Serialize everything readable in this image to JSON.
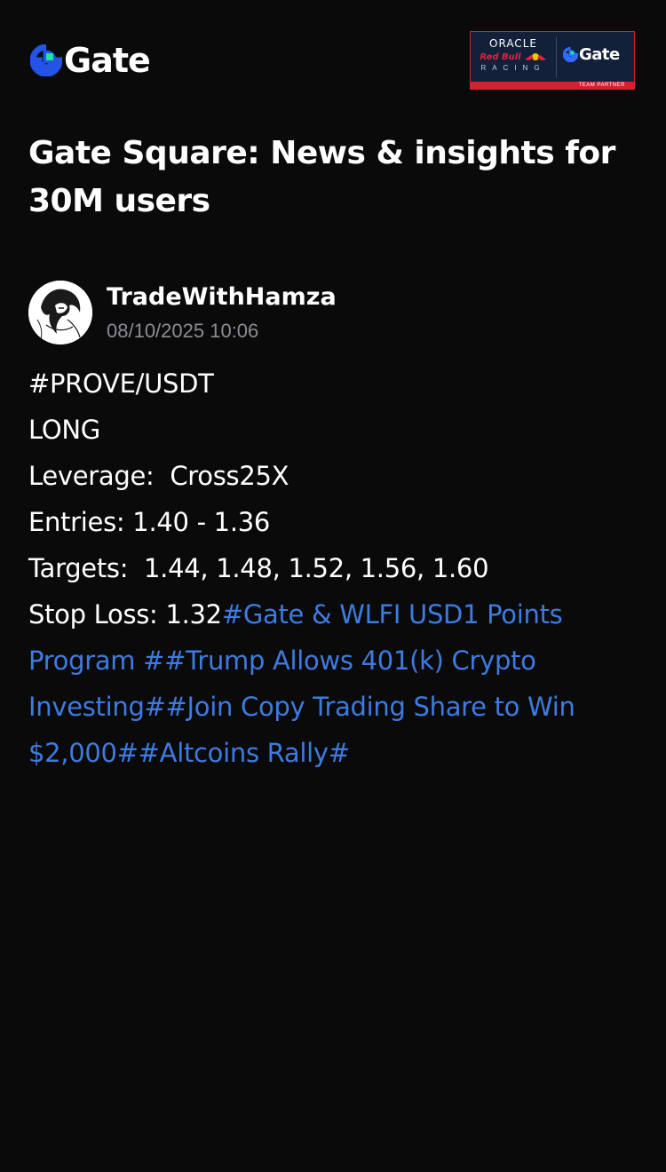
{
  "header": {
    "logo_text": "Gate",
    "logo_icon": "gate-logo-icon",
    "partner": {
      "oracle": "ORACLE",
      "redbull": "Red Bull",
      "racing": "RACING",
      "gate_text": "Gate",
      "strip_text": "TEAM PARTNER"
    }
  },
  "headline": "Gate Square: News & insights for 30M users",
  "post": {
    "author": "TradeWithHamza",
    "date": "08/10/2025 10:06",
    "lines": [
      "#PROVE/USDT",
      "LONG",
      "Leverage:  Cross25X",
      "Entries: 1.40 - 1.36",
      "Targets:  1.44, 1.48, 1.52, 1.56, 1.60"
    ],
    "stop_loss": "Stop Loss: 1.32",
    "hashtags": "#Gate & WLFI USD1 Points Program ##Trump Allows 401(k) Crypto Investing##Join Copy Trading Share to Win $2,000##Altcoins Rally#"
  },
  "colors": {
    "background": "#0a0a0b",
    "hashtag": "#3d7be0",
    "brand_blue": "#2354e6",
    "brand_green": "#17e6a1",
    "muted": "#8a8d94"
  }
}
